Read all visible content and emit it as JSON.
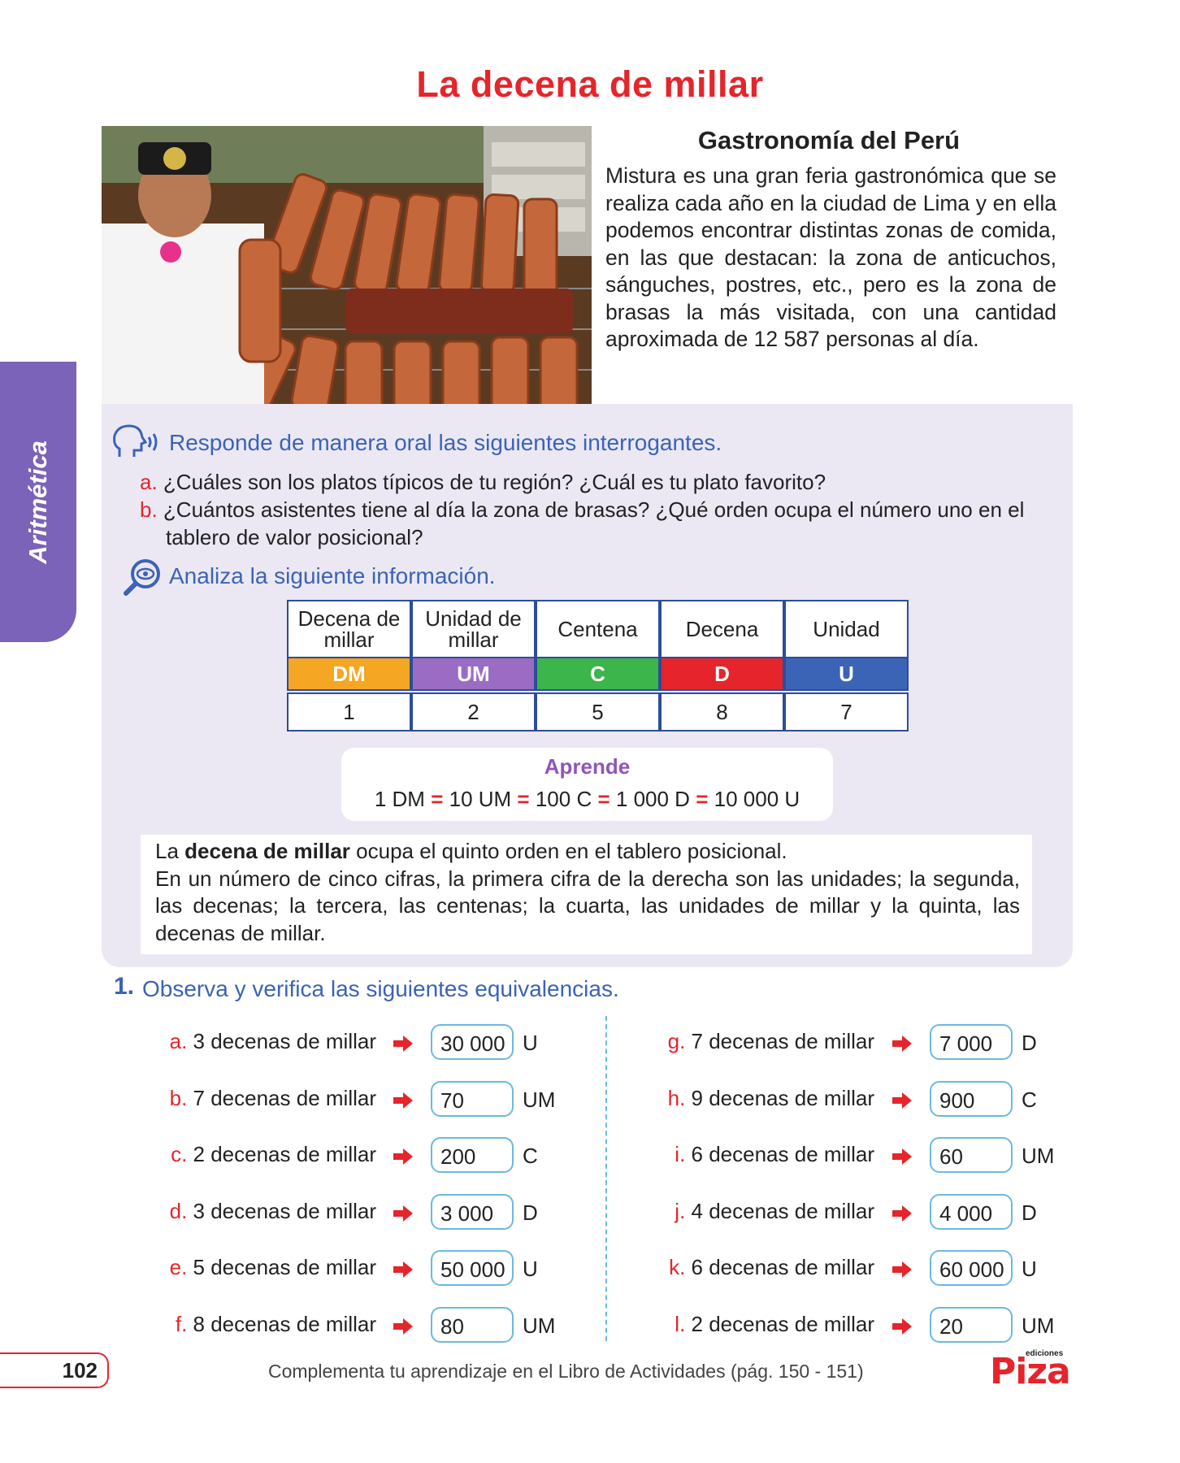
{
  "side_tab": "Aritmética",
  "title": "La decena de millar",
  "intro": {
    "heading": "Gastronomía del Perú",
    "text": "Mistura es una gran feria gastronómica que se realiza cada año en la ciudad de Lima y en ella podemos encontrar distintas zonas de comida, en las que destacan: la zona de anticuchos, sánguches, postres, etc., pero es la zona de brasas la más visitada, con una cantidad aproximada de 12 587 personas al día."
  },
  "oral": {
    "heading": "Responde de manera oral las siguientes interrogantes.",
    "questions": [
      {
        "letter": "a.",
        "text": "¿Cuáles son los platos típicos de tu región? ¿Cuál es tu plato favorito?"
      },
      {
        "letter": "b.",
        "text": "¿Cuántos asistentes tiene al día la zona de brasas? ¿Qué orden ocupa el número uno en el tablero de valor posicional?"
      }
    ]
  },
  "analyze": {
    "heading": "Analiza la siguiente información."
  },
  "place_table": {
    "headers": [
      "Decena de millar",
      "Unidad de millar",
      "Centena",
      "Decena",
      "Unidad"
    ],
    "abbr": [
      "DM",
      "UM",
      "C",
      "D",
      "U"
    ],
    "values": [
      "1",
      "2",
      "5",
      "8",
      "7"
    ],
    "colors": [
      "#f5a623",
      "#9b6cc4",
      "#3cb54a",
      "#e5252b",
      "#3b63b6"
    ]
  },
  "aprende": {
    "title": "Aprende",
    "parts": [
      "1 DM",
      "10 UM",
      "100 C",
      "1 000 D",
      "10 000 U"
    ],
    "sign": "="
  },
  "definition": {
    "pre": "La ",
    "bold": "decena de millar",
    "rest": " ocupa el quinto orden en el tablero posicional.",
    "text2": "En un número de cinco cifras, la primera cifra de la derecha son las unidades; la segunda, las decenas; la tercera, las centenas; la cuarta, las unidades de millar y la quinta, las decenas de millar."
  },
  "exercise": {
    "number": "1.",
    "title": "Observa y verifica las siguientes equivalencias.",
    "left": [
      {
        "letter": "a.",
        "text": "3 decenas de millar",
        "answer": "30 000",
        "unit": "U"
      },
      {
        "letter": "b.",
        "text": "7 decenas de millar",
        "answer": "70",
        "unit": "UM"
      },
      {
        "letter": "c.",
        "text": "2 decenas de millar",
        "answer": "200",
        "unit": "C"
      },
      {
        "letter": "d.",
        "text": "3 decenas de millar",
        "answer": "3 000",
        "unit": "D"
      },
      {
        "letter": "e.",
        "text": "5 decenas de millar",
        "answer": "50 000",
        "unit": "U"
      },
      {
        "letter": "f.",
        "text": "8 decenas de millar",
        "answer": "80",
        "unit": "UM"
      }
    ],
    "right": [
      {
        "letter": "g.",
        "text": "7 decenas de millar",
        "answer": "7 000",
        "unit": "D"
      },
      {
        "letter": "h.",
        "text": "9 decenas de millar",
        "answer": "900",
        "unit": "C"
      },
      {
        "letter": "i.",
        "text": "6 decenas de millar",
        "answer": "60",
        "unit": "UM"
      },
      {
        "letter": "j.",
        "text": "4 decenas de millar",
        "answer": "4 000",
        "unit": "D"
      },
      {
        "letter": "k.",
        "text": "6 decenas de millar",
        "answer": "60 000",
        "unit": "U"
      },
      {
        "letter": "l.",
        "text": "2 decenas de millar",
        "answer": "20",
        "unit": "UM"
      }
    ]
  },
  "footer": {
    "page_number": "102",
    "text": "Complementa tu aprendizaje en el Libro de Actividades (pág. 150 - 151)",
    "logo_small": "ediciones",
    "logo": "Piza"
  },
  "colors": {
    "title_red": "#e5252b",
    "heading_blue": "#3b63b6",
    "panel_lilac": "#ebe8f4",
    "tab_purple": "#7a63b8",
    "box_border": "#6bb9df"
  }
}
